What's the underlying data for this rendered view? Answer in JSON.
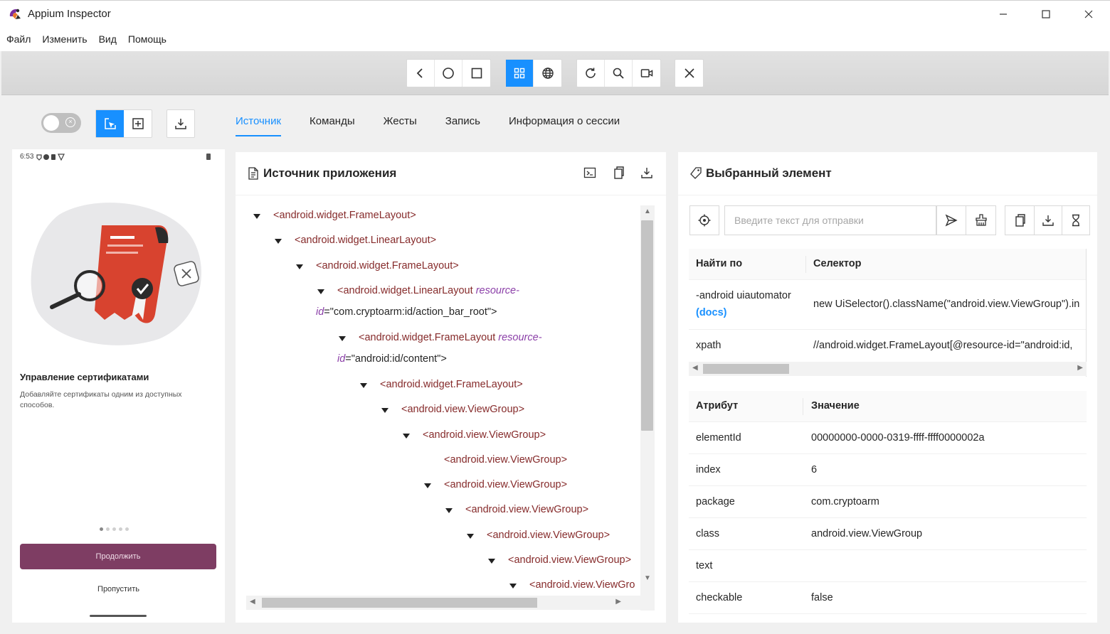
{
  "window": {
    "title": "Appium Inspector",
    "minimize": "—",
    "maximize": "☐",
    "close": "✕"
  },
  "menu": [
    "Файл",
    "Изменить",
    "Вид",
    "Помощь"
  ],
  "tabs": [
    {
      "label": "Источник",
      "active": true
    },
    {
      "label": "Команды",
      "active": false
    },
    {
      "label": "Жесты",
      "active": false
    },
    {
      "label": "Запись",
      "active": false
    },
    {
      "label": "Информация о сессии",
      "active": false
    }
  ],
  "phone": {
    "time": "6:53",
    "title": "Управление сертификатами",
    "description": "Добавляйте сертификаты одним из доступных способов.",
    "continue_label": "Продолжить",
    "skip_label": "Пропустить",
    "page_dots": 5,
    "active_dot": 1,
    "accent_color": "#7e3d63"
  },
  "source": {
    "title": "Источник приложения",
    "tree": [
      {
        "level": 0,
        "caret": true,
        "tag": "<android.widget.FrameLayout>"
      },
      {
        "level": 1,
        "caret": true,
        "tag": "<android.widget.LinearLayout>"
      },
      {
        "level": 2,
        "caret": true,
        "tag": "<android.widget.FrameLayout>"
      },
      {
        "level": 3,
        "caret": true,
        "tag": "<android.widget.LinearLayout",
        "attr1": "resource-",
        "attr2": "id",
        "val": "=\"com.cryptoarm:id/action_bar_root\">"
      },
      {
        "level": 4,
        "caret": true,
        "tag": "<android.widget.FrameLayout",
        "attr1": "resource-",
        "attr2": "id",
        "val": "=\"android:id/content\">"
      },
      {
        "level": 5,
        "caret": true,
        "tag": "<android.widget.FrameLayout>"
      },
      {
        "level": 6,
        "caret": true,
        "tag": "<android.view.ViewGroup>"
      },
      {
        "level": 7,
        "caret": true,
        "tag": "<android.view.ViewGroup>"
      },
      {
        "level": 8,
        "caret": false,
        "tag": "<android.view.ViewGroup>"
      },
      {
        "level": 8,
        "caret": true,
        "tag": "<android.view.ViewGroup>"
      },
      {
        "level": 9,
        "caret": true,
        "tag": "<android.view.ViewGroup>"
      },
      {
        "level": 10,
        "caret": true,
        "tag": "<android.view.ViewGroup>"
      },
      {
        "level": 11,
        "caret": true,
        "tag": "<android.view.ViewGroup>"
      },
      {
        "level": 12,
        "caret": true,
        "tag": "<android.view.ViewGro"
      }
    ]
  },
  "selected": {
    "title": "Выбранный элемент",
    "send_placeholder": "Введите текст для отправки",
    "find_header": {
      "by": "Найти по",
      "selector": "Селектор"
    },
    "find_rows": [
      {
        "by": "-android uiautomator",
        "docs": "(docs)",
        "selector": "new UiSelector().className(\"android.view.ViewGroup\").in"
      },
      {
        "by": "xpath",
        "selector": "//android.widget.FrameLayout[@resource-id=\"android:id,"
      }
    ],
    "attr_header": {
      "attr": "Атрибут",
      "value": "Значение"
    },
    "attributes": [
      {
        "name": "elementId",
        "value": "00000000-0000-0319-ffff-ffff0000002a"
      },
      {
        "name": "index",
        "value": "6"
      },
      {
        "name": "package",
        "value": "com.cryptoarm"
      },
      {
        "name": "class",
        "value": "android.view.ViewGroup"
      },
      {
        "name": "text",
        "value": ""
      },
      {
        "name": "checkable",
        "value": "false"
      }
    ]
  },
  "colors": {
    "accent": "#1890ff",
    "tag": "#862b2b",
    "attr": "#8b3fa8"
  }
}
